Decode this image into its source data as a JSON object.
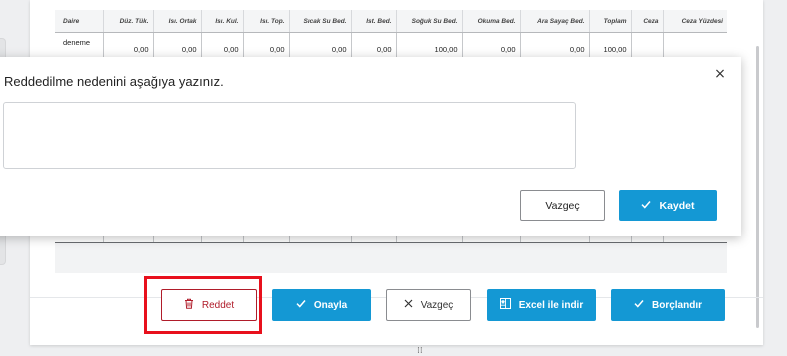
{
  "table": {
    "headers": [
      "Daire",
      "Düz. Tük.",
      "Isı. Ortak",
      "Isı. Kul.",
      "Isı. Top.",
      "Sıcak Su Bed.",
      "Ist. Bed.",
      "Soğuk Su Bed.",
      "Okuma Bed.",
      "Ara Sayaç Bed.",
      "Toplam",
      "Ceza",
      "Ceza Yüzdesi"
    ],
    "rows": [
      [
        "deneme",
        "0,00",
        "0,00",
        "0,00",
        "0,00",
        "0,00",
        "0,00",
        "100,00",
        "0,00",
        "0,00",
        "100,00",
        "",
        ""
      ]
    ]
  },
  "footer": {
    "reject_label": "Reddet",
    "approve_label": "Onayla",
    "cancel_label": "Vazgeç",
    "excel_label": "Excel ile indir",
    "debit_label": "Borçlandır"
  },
  "modal": {
    "title": "Reddedilme nedenini aşağıya yazınız.",
    "reason_value": "",
    "cancel_label": "Vazgeç",
    "save_label": "Kaydet"
  },
  "colors": {
    "primary": "#1498d4",
    "danger": "#b01c2a",
    "highlight": "#e8101c"
  },
  "icons": {
    "reject": "trash-icon",
    "approve": "check-icon",
    "cancel": "x-icon",
    "excel": "excel-icon",
    "debit": "check-icon",
    "close": "close-icon"
  }
}
